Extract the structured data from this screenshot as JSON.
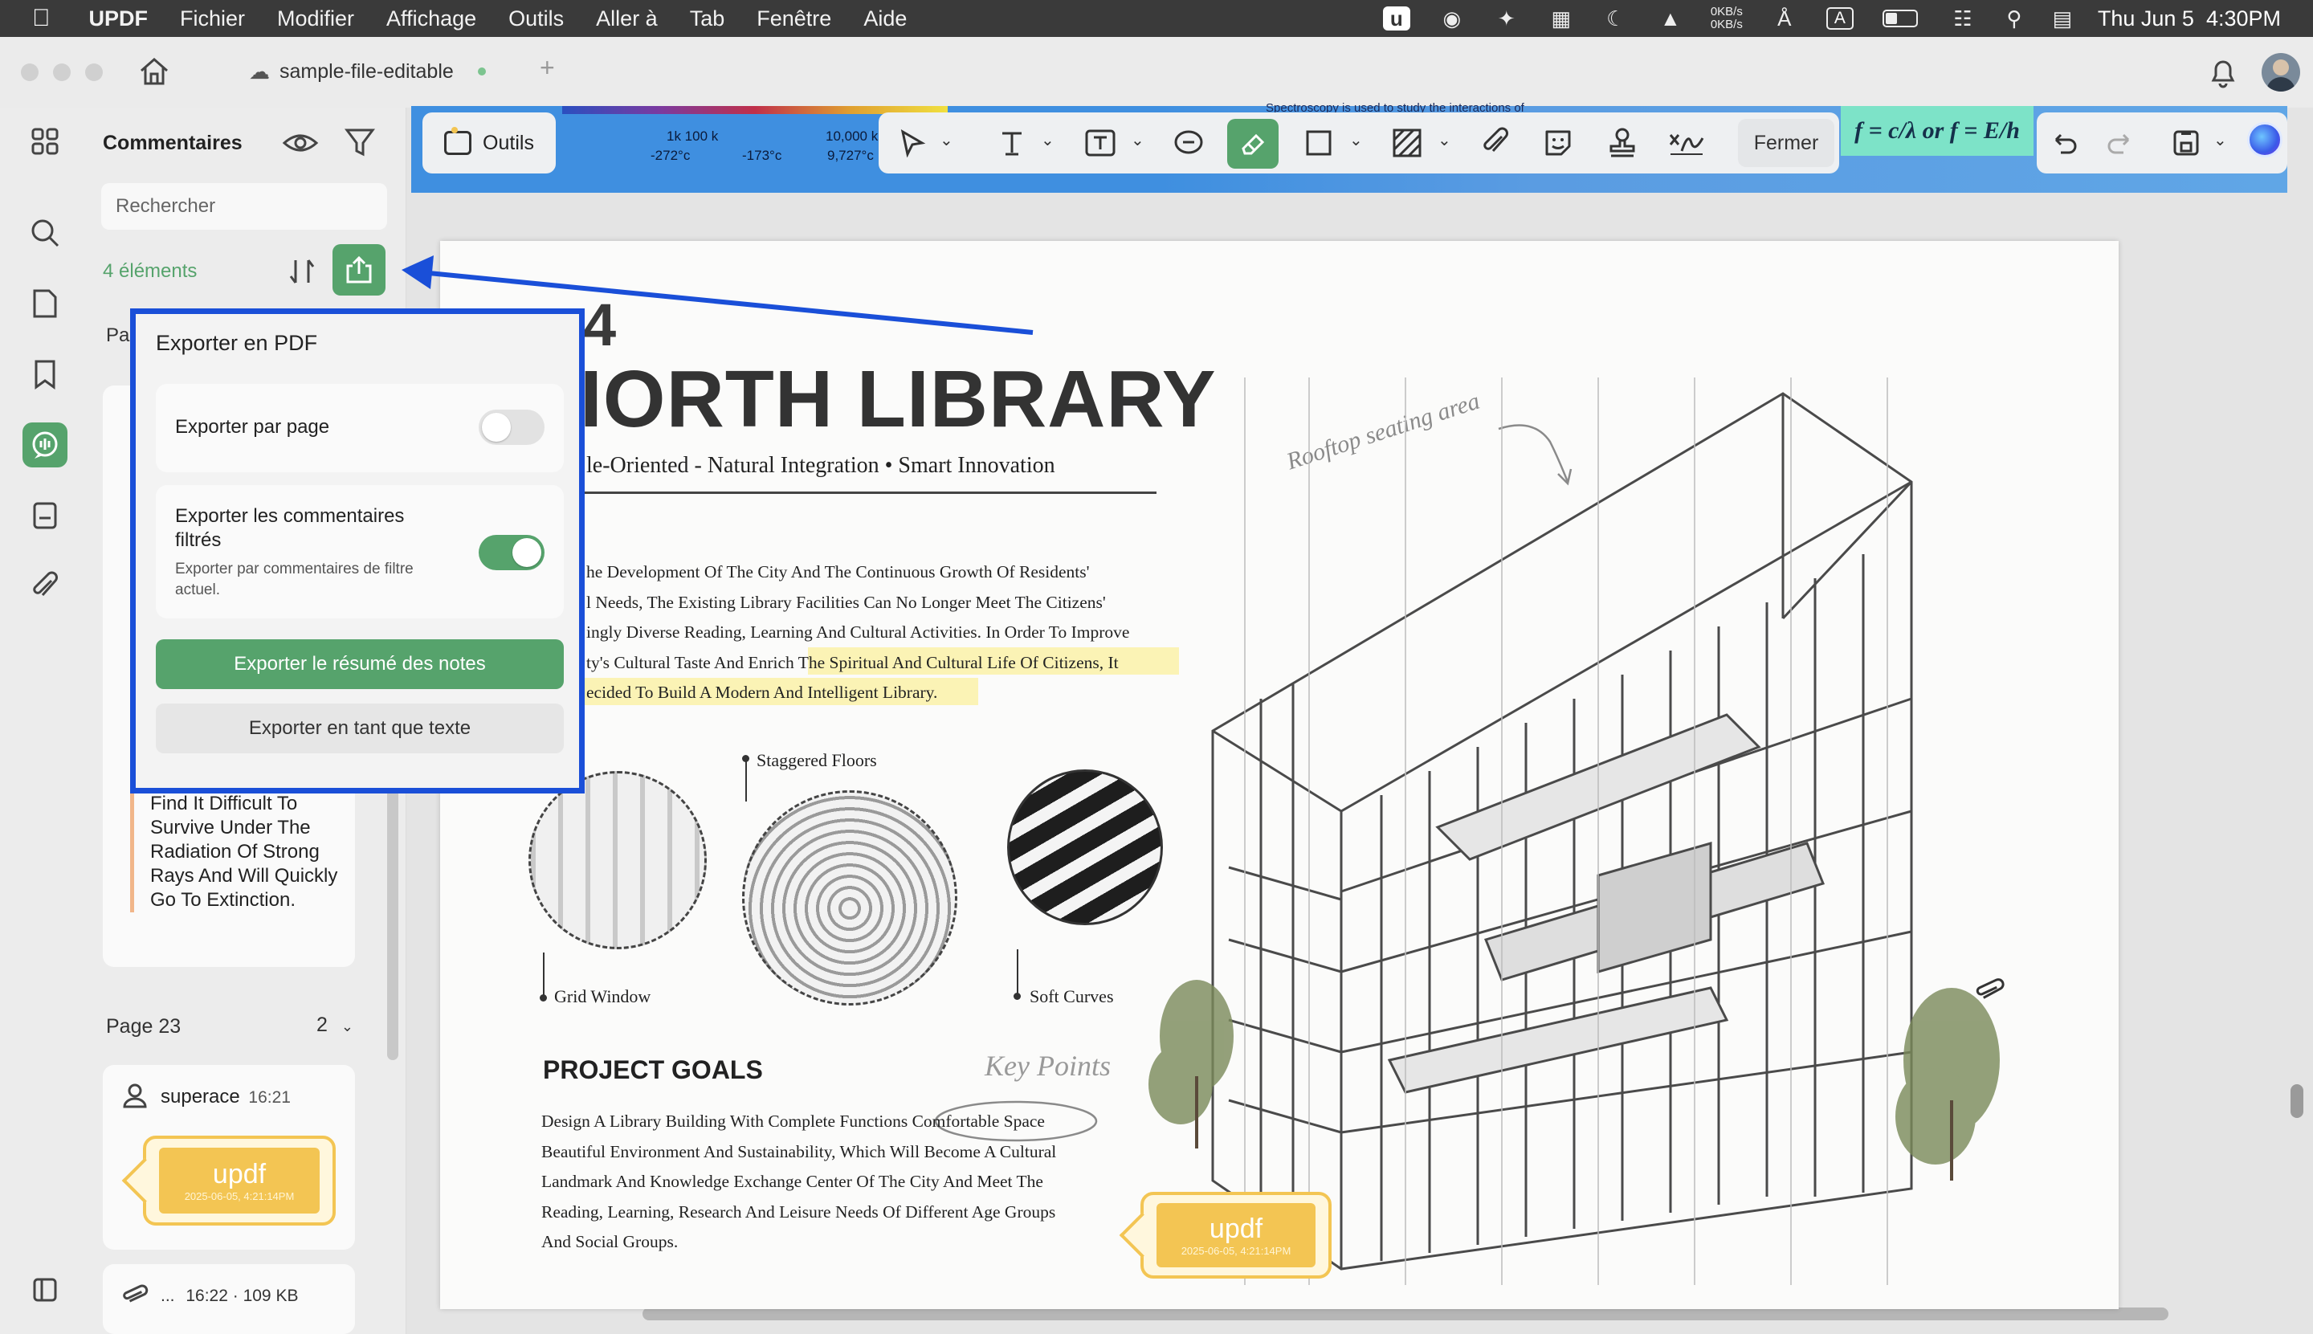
{
  "menubar": {
    "app": "UPDF",
    "items": [
      "Fichier",
      "Modifier",
      "Affichage",
      "Outils",
      "Aller à",
      "Tab",
      "Fenêtre",
      "Aide"
    ],
    "net_up": "0KB/s",
    "net_down": "0KB/s",
    "input_source": "A",
    "datetime": "Thu Jun 5  4:30PM"
  },
  "tab": {
    "title": "sample-file-editable",
    "add": "+"
  },
  "panel": {
    "title": "Commentaires",
    "search_placeholder": "Rechercher",
    "count": "4 éléments",
    "page_header_partial": "Pa",
    "note_text": "Find It Difficult To Survive Under The Radiation Of Strong Rays And Will Quickly Go To Extinction.",
    "page23_label": "Page 23",
    "page23_count": "2",
    "comment_user": "superace",
    "comment_time": "16:21",
    "stamp_text": "updf",
    "stamp_date": "2025-06-05, 4:21:14PM",
    "attachment_text": "...",
    "attachment_meta": "16:22 · 109 KB"
  },
  "popup": {
    "title": "Exporter en PDF",
    "option1_label": "Exporter par page",
    "option1_on": false,
    "option2_label": "Exporter les commentaires filtrés",
    "option2_desc": "Exporter par commentaires de filtre actuel.",
    "option2_on": true,
    "primary_button": "Exporter le résumé des notes",
    "secondary_button": "Exporter en tant que texte"
  },
  "toolbar": {
    "tools_button": "Outils",
    "close_button": "Fermer",
    "spectrum_labels": [
      "1k 100 k",
      "-272°c",
      "-173°c",
      "10,000 k",
      "9,727°c"
    ],
    "spectrum_caption": "Spectroscopy is used to study the interactions of",
    "formula_text": "f = c/λ or f = E/h"
  },
  "document": {
    "page_number_partial": "4",
    "title": "IORTH LIBRARY",
    "subtitle": "le-Oriented - Natural Integration • Smart Innovation",
    "paragraph_lines": [
      "he Development Of The City And The Continuous Growth Of Residents'",
      "l Needs, The Existing Library Facilities Can No Longer Meet The Citizens'",
      "ingly Diverse Reading, Learning And Cultural Activities. In Order To Improve",
      "ty's Cultural Taste And Enrich The Spiritual And Cultural Life Of Citizens, It",
      "ecided To Build A Modern And Intelligent Library."
    ],
    "highlight_part": "The Spiritual And Cultural Life Of Citizens, It",
    "handwriting_top": "Rooftop seating area",
    "label_grid": "Grid Window",
    "label_staggered": "Staggered Floors",
    "label_soft": "Soft Curves",
    "goals_title": "PROJECT GOALS",
    "handwriting_key": "Key Points",
    "goals_lines": [
      "Design A Library Building With Complete Functions Comfortable Space",
      "Beautiful Environment And Sustainability, Which Will Become A Cultural",
      "Landmark And Knowledge Exchange Center Of The City And Meet The",
      "Reading, Learning, Research And Leisure Needs Of Different Age Groups",
      "And Social Groups."
    ],
    "stamp_text": "updf",
    "stamp_date": "2025-06-05, 4:21:14PM"
  },
  "colors": {
    "accent_green": "#56a36c",
    "callout_blue": "#1a4fd8",
    "stamp_yellow": "#f3c553"
  }
}
